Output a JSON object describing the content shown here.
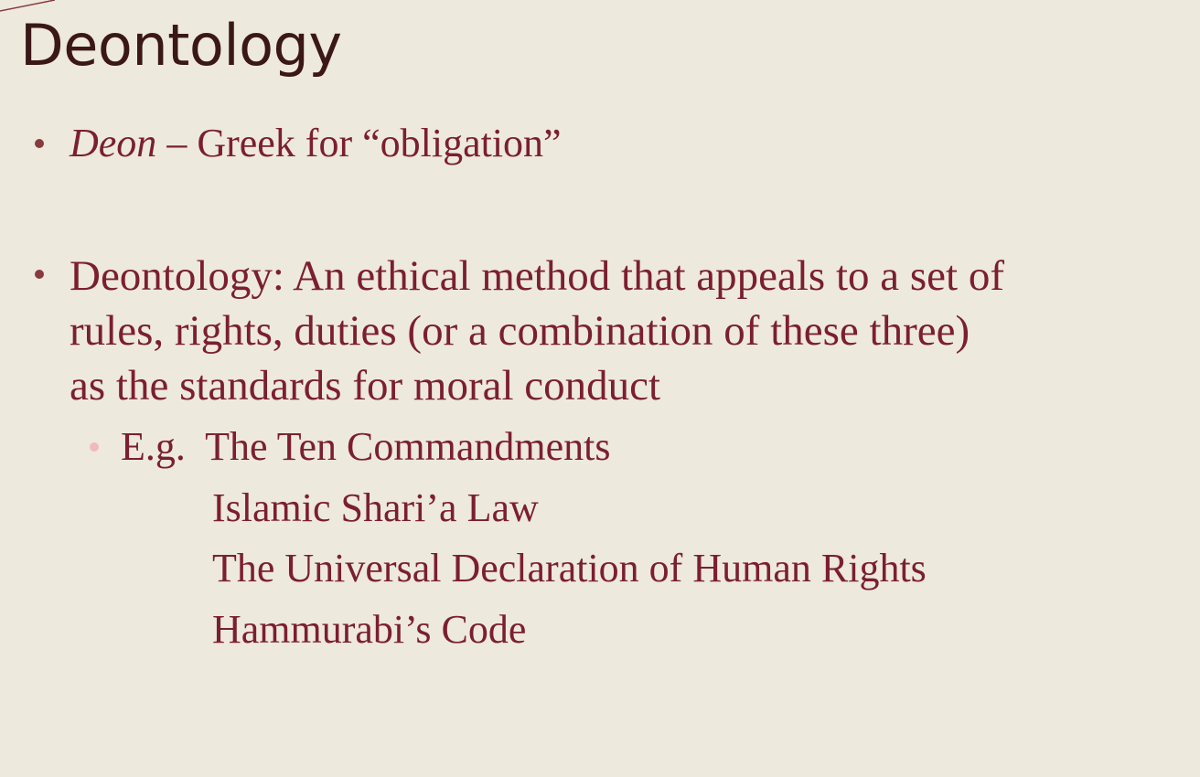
{
  "slide": {
    "title": "Deontology",
    "bullet1": {
      "term": "Deon",
      "rest": " – Greek for “obligation”"
    },
    "bullet2": {
      "lines": [
        "Deontology: An ethical method that appeals to a set of",
        "rules, rights,  duties (or a combination of these three)",
        "as the standards for moral conduct"
      ]
    },
    "sub_bullet": {
      "prefix": "E.g.  ",
      "first_example": "The Ten Commandments",
      "more_examples": [
        "Islamic Shari’a Law",
        "The Universal Declaration of Human Rights",
        "Hammurabi’s Code"
      ]
    },
    "colors": {
      "background": "#ede9dc",
      "title": "#3b1717",
      "body_text": "#7b1f2e",
      "bullet": "#8a3a3e",
      "sub_bullet": "#f2b9bd"
    }
  }
}
